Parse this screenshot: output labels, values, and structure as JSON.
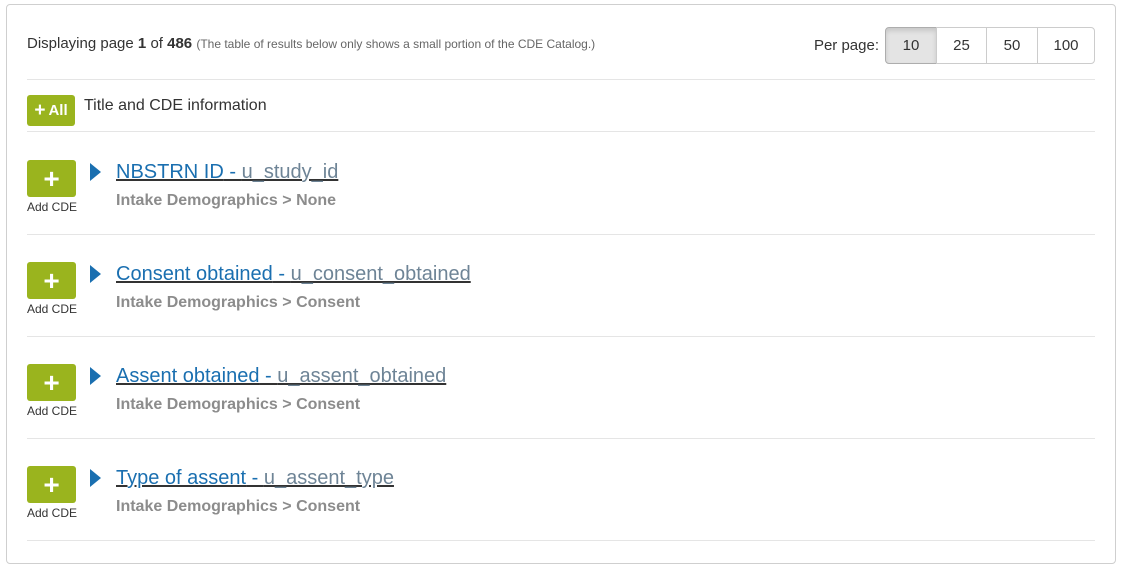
{
  "topbar": {
    "display_prefix": "Displaying page",
    "current_page": "1",
    "of_label": "of",
    "total_pages": "486",
    "note": "(The table of results below only shows a small portion of the CDE Catalog.)",
    "per_page_label": "Per page:",
    "per_page_options": [
      "10",
      "25",
      "50",
      "100"
    ],
    "per_page_selected": "10"
  },
  "header": {
    "add_all_label": "All",
    "title": "Title and CDE information"
  },
  "rows": [
    {
      "add_label": "Add CDE",
      "name": "NBSTRN ID",
      "separator": " - ",
      "variable": "u_study_id",
      "path": "Intake Demographics > None"
    },
    {
      "add_label": "Add CDE",
      "name": "Consent obtained",
      "separator": " - ",
      "variable": "u_consent_obtained",
      "path": "Intake Demographics > Consent"
    },
    {
      "add_label": "Add CDE",
      "name": "Assent obtained",
      "separator": " - ",
      "variable": "u_assent_obtained",
      "path": "Intake Demographics > Consent"
    },
    {
      "add_label": "Add CDE",
      "name": "Type of assent",
      "separator": " - ",
      "variable": "u_assent_type",
      "path": "Intake Demographics > Consent"
    }
  ],
  "colors": {
    "add_button": "#9ab41e",
    "title_link": "#1a6fb0",
    "variable_link": "#6e8496",
    "path_text": "#8c8c8c"
  },
  "icons": {
    "add": "plus-icon",
    "expand": "caret-right-icon"
  }
}
